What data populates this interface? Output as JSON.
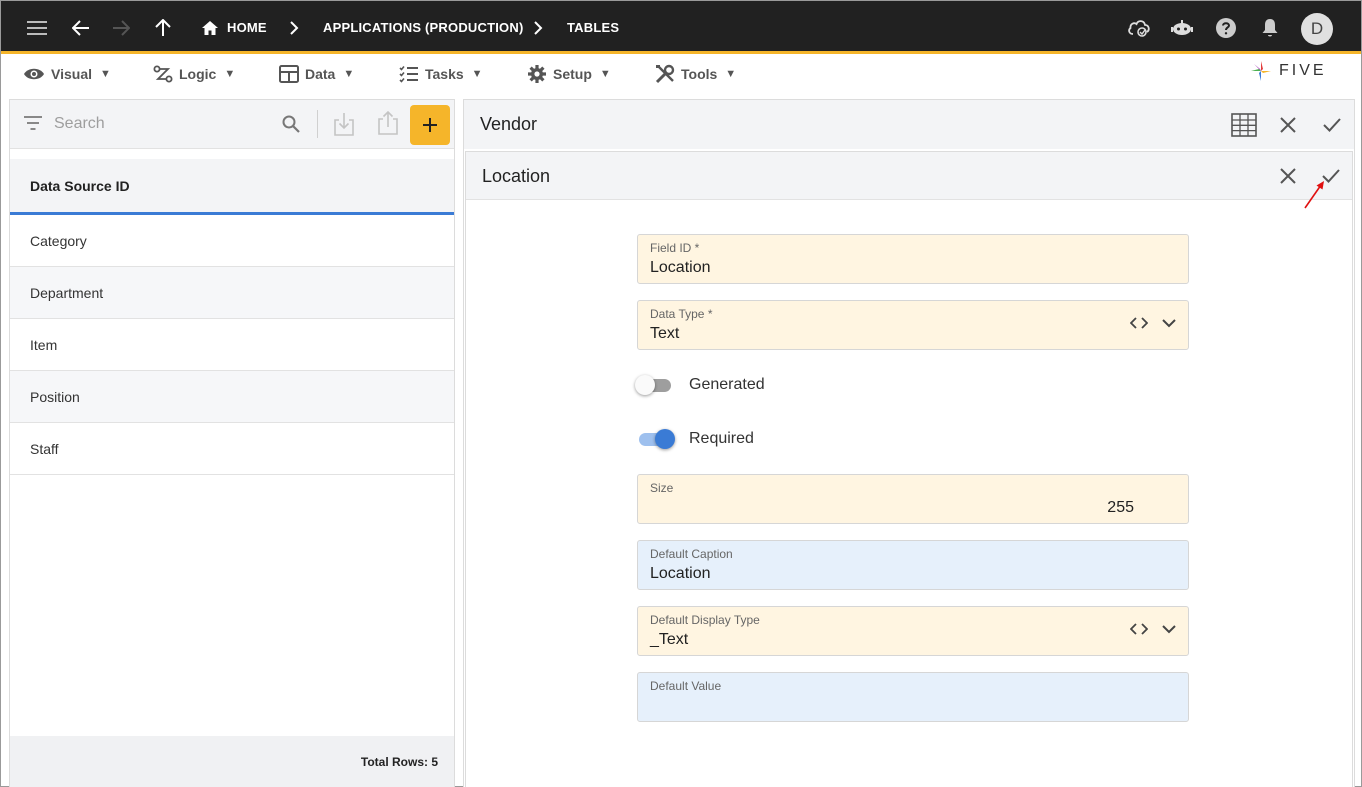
{
  "topbar": {
    "breadcrumb": [
      "HOME",
      "APPLICATIONS (PRODUCTION)",
      "TABLES"
    ],
    "avatar_initial": "D"
  },
  "menubar": {
    "items": [
      "Visual",
      "Logic",
      "Data",
      "Tasks",
      "Setup",
      "Tools"
    ],
    "caret": "▼",
    "logo_text": "FIVE"
  },
  "left_panel": {
    "search_placeholder": "Search",
    "column_header": "Data Source ID",
    "items": [
      "Category",
      "Department",
      "Item",
      "Position",
      "Staff"
    ],
    "footer": "Total Rows: 5"
  },
  "vendor_panel": {
    "title": "Vendor"
  },
  "location_panel": {
    "title": "Location",
    "fields": {
      "field_id": {
        "label": "Field ID *",
        "value": "Location"
      },
      "data_type": {
        "label": "Data Type *",
        "value": "Text"
      },
      "generated": {
        "label": "Generated",
        "on": false
      },
      "required": {
        "label": "Required",
        "on": true
      },
      "size": {
        "label": "Size",
        "value": "255"
      },
      "default_caption": {
        "label": "Default Caption",
        "value": "Location"
      },
      "default_display_type": {
        "label": "Default Display Type",
        "value": "_Text"
      },
      "default_value": {
        "label": "Default Value",
        "value": ""
      }
    }
  },
  "colors": {
    "topbar_bg": "#212121",
    "accent_yellow": "#f5b52a",
    "accent_blue": "#3a7bd5",
    "annotation_red": "#e01010"
  }
}
